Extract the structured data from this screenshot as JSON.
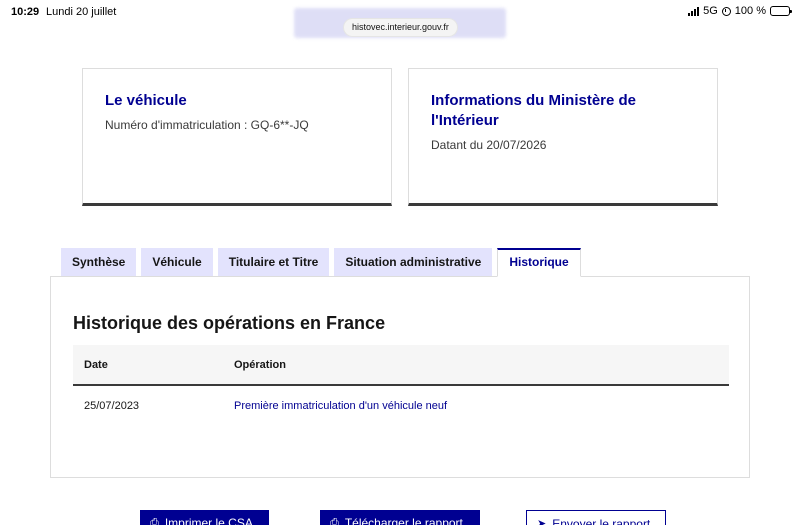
{
  "status_bar": {
    "time": "10:29",
    "date": "Lundi 20 juillet",
    "network": "5G",
    "battery": "100 %"
  },
  "browser": {
    "url": "histovec.interieur.gouv.fr"
  },
  "cards": {
    "vehicle": {
      "title": "Le véhicule",
      "text": "Numéro d'immatriculation : GQ-6**-JQ"
    },
    "ministry": {
      "title": "Informations du Ministère de l'Intérieur",
      "text": "Datant du 20/07/2026"
    }
  },
  "tabs": [
    {
      "label": "Synthèse",
      "active": false
    },
    {
      "label": "Véhicule",
      "active": false
    },
    {
      "label": "Titulaire et Titre",
      "active": false
    },
    {
      "label": "Situation administrative",
      "active": false
    },
    {
      "label": "Historique",
      "active": true
    }
  ],
  "history": {
    "title": "Historique des opérations en France",
    "columns": [
      "Date",
      "Opération"
    ],
    "rows": [
      {
        "date": "25/07/2023",
        "operation": "Première immatriculation d'un véhicule neuf"
      }
    ]
  },
  "actions": {
    "print": "Imprimer le CSA",
    "download": "Télécharger le rapport",
    "send": "Envoyer le rapport"
  },
  "colors": {
    "primary": "#000091",
    "tab_bg": "#e3e3fd"
  }
}
